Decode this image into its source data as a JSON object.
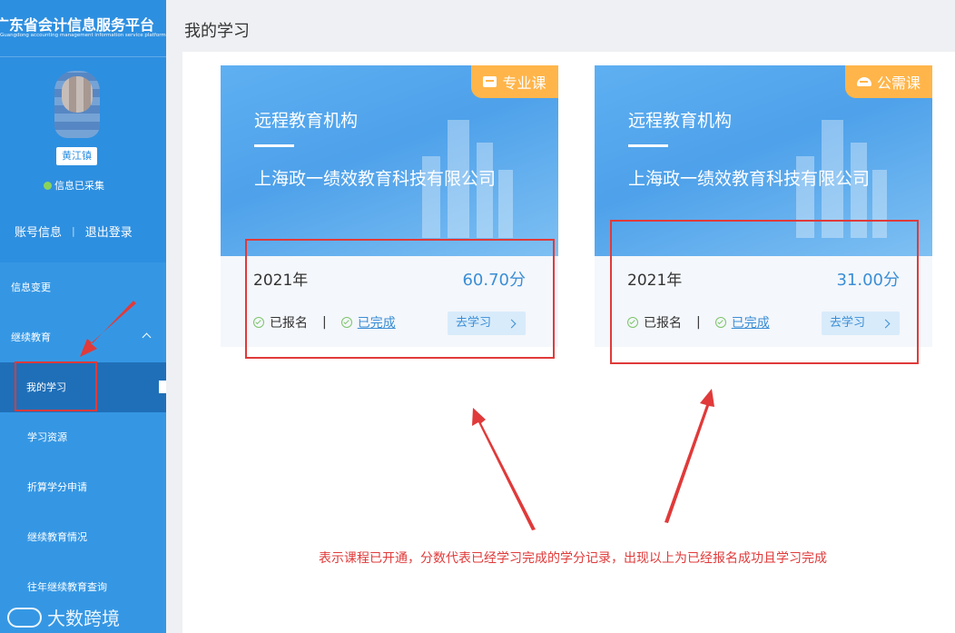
{
  "brand": {
    "title": "广东省会计信息服务平台",
    "subtitle": "Guangdong accounting management information service platform"
  },
  "user": {
    "name": "黄江镇",
    "status": "信息已采集"
  },
  "account": {
    "info_label": "账号信息",
    "separator": "|",
    "logout_label": "退出登录"
  },
  "menu": {
    "info_change": "信息变更",
    "continuing_education": "继续教育",
    "my_study": "我的学习",
    "study_resources": "学习资源",
    "credit_conversion": "折算学分申请",
    "edu_status": "继续教育情况",
    "history_query": "往年继续教育查询"
  },
  "page": {
    "title": "我的学习"
  },
  "cards": [
    {
      "tag": "专业课",
      "org_label": "远程教育机构",
      "org_name": "上海政一绩效教育科技有限公司",
      "year": "2021年",
      "score": "60.70分",
      "enrolled": "已报名",
      "sep": "|",
      "completed": "已完成",
      "button": "去学习"
    },
    {
      "tag": "公需课",
      "org_label": "远程教育机构",
      "org_name": "上海政一绩效教育科技有限公司",
      "year": "2021年",
      "score": "31.00分",
      "enrolled": "已报名",
      "sep": "|",
      "completed": "已完成",
      "button": "去学习"
    }
  ],
  "annotation": {
    "note": "表示课程已开通，分数代表已经学习完成的学分记录，出现以上为已经报名成功且学习完成"
  },
  "watermark": {
    "text": "大数跨境"
  },
  "colors": {
    "sidebar": "#2d8fe0",
    "active_menu": "#1f6fb8",
    "accent_blue": "#3b8ed6",
    "tag_orange": "#ffb54a",
    "annotation_red": "#e03a3a"
  }
}
